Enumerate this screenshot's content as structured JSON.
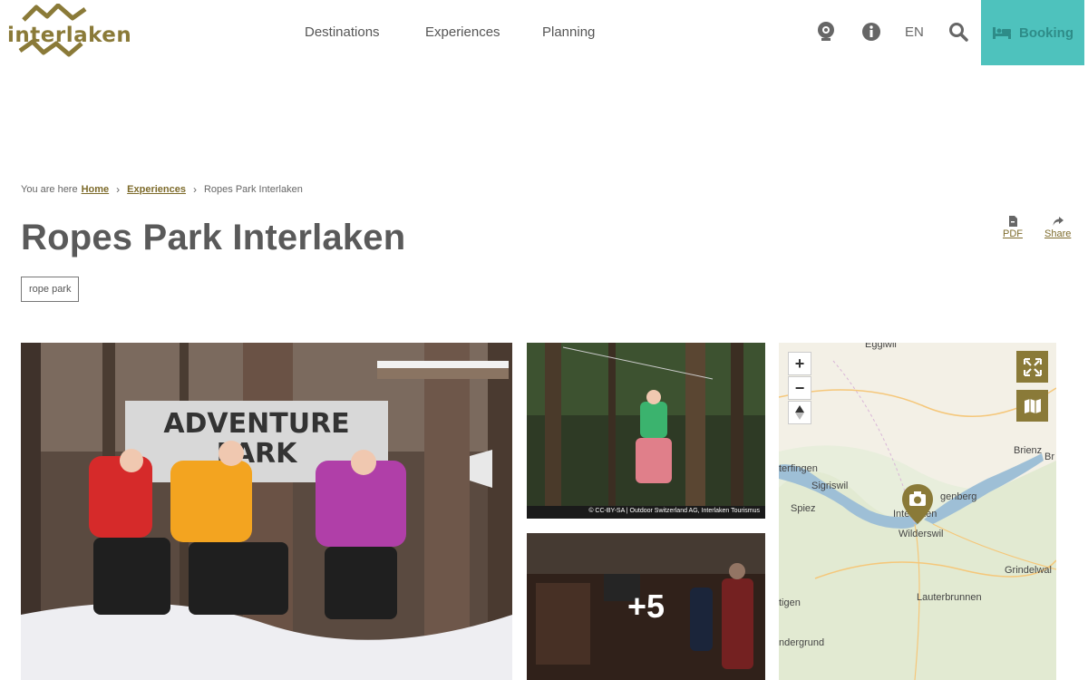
{
  "logo": {
    "text": "interlaken"
  },
  "nav": {
    "items": [
      "Destinations",
      "Experiences",
      "Planning"
    ]
  },
  "header": {
    "lang": "EN",
    "booking_label": "Booking"
  },
  "breadcrumb": {
    "prefix": "You are here",
    "home": "Home",
    "experiences": "Experiences",
    "current": "Ropes Park Interlaken"
  },
  "page": {
    "title": "Ropes Park Interlaken",
    "tag": "rope park"
  },
  "tools": {
    "pdf": "PDF",
    "share": "Share"
  },
  "gallery": {
    "main_sign": "ADVENTURE PARK",
    "credit": "© CC-BY-SA | Outdoor Switzerland AG, Interlaken Tourismus",
    "more": "+5"
  },
  "map": {
    "zoom_in": "+",
    "zoom_out": "−",
    "labels": {
      "eggiwil": "Eggiwil",
      "brienz": "Brienz",
      "br": "Br",
      "sigriswil": "Sigriswil",
      "terfingen": "terfingen",
      "spiez": "Spiez",
      "interlaken": "Interlaken",
      "genberg": "genberg",
      "wilderswil": "Wilderswil",
      "grindelwald": "Grindelwal",
      "lauterbrunnen": "Lauterbrunnen",
      "aeschi": "tigen",
      "grund": "ndergrund"
    }
  },
  "colors": {
    "accent": "#4ec2bd",
    "brand": "#8a7a38"
  }
}
